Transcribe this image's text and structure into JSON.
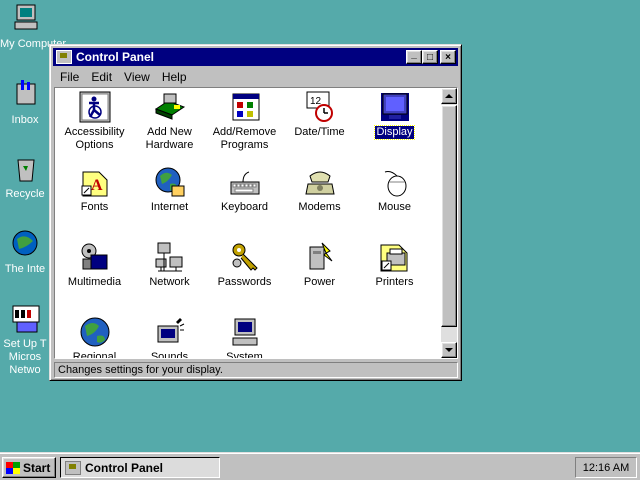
{
  "desktop": {
    "icons": [
      {
        "label": "My Computer",
        "icon": "my-computer-icon"
      },
      {
        "label": "Inbox",
        "icon": "inbox-icon"
      },
      {
        "label": "Recycle",
        "icon": "recycle-bin-icon"
      },
      {
        "label": "The Inte",
        "icon": "internet-explorer-icon"
      },
      {
        "label_lines": [
          "Set Up T",
          "Micros",
          "Netwo"
        ],
        "icon": "msn-icon"
      }
    ]
  },
  "window": {
    "title": "Control Panel",
    "buttons": {
      "minimize": "_",
      "maximize": "□",
      "close": "×"
    },
    "menu": [
      "File",
      "Edit",
      "View",
      "Help"
    ],
    "status": "Changes settings for your display.",
    "items": [
      {
        "label_lines": [
          "Accessibility",
          "Options"
        ],
        "icon": "accessibility-icon"
      },
      {
        "label_lines": [
          "Add New",
          "Hardware"
        ],
        "icon": "add-hardware-icon"
      },
      {
        "label_lines": [
          "Add/Remove",
          "Programs"
        ],
        "icon": "add-remove-programs-icon"
      },
      {
        "label_lines": [
          "Date/Time"
        ],
        "icon": "date-time-icon"
      },
      {
        "label_lines": [
          "Display"
        ],
        "icon": "display-icon",
        "selected": true
      },
      {
        "label_lines": [
          "Fonts"
        ],
        "icon": "fonts-icon"
      },
      {
        "label_lines": [
          "Internet"
        ],
        "icon": "internet-icon"
      },
      {
        "label_lines": [
          "Keyboard"
        ],
        "icon": "keyboard-icon"
      },
      {
        "label_lines": [
          "Modems"
        ],
        "icon": "modem-icon"
      },
      {
        "label_lines": [
          "Mouse"
        ],
        "icon": "mouse-icon"
      },
      {
        "label_lines": [
          "Multimedia"
        ],
        "icon": "multimedia-icon"
      },
      {
        "label_lines": [
          "Network"
        ],
        "icon": "network-icon"
      },
      {
        "label_lines": [
          "Passwords"
        ],
        "icon": "passwords-icon"
      },
      {
        "label_lines": [
          "Power"
        ],
        "icon": "power-icon"
      },
      {
        "label_lines": [
          "Printers"
        ],
        "icon": "printers-icon"
      },
      {
        "label_lines": [
          "Regional"
        ],
        "icon": "regional-settings-icon"
      },
      {
        "label_lines": [
          "Sounds"
        ],
        "icon": "sounds-icon"
      },
      {
        "label_lines": [
          "System"
        ],
        "icon": "system-icon"
      }
    ]
  },
  "taskbar": {
    "start_label": "Start",
    "task_label": "Control Panel",
    "clock": "12:16 AM"
  }
}
